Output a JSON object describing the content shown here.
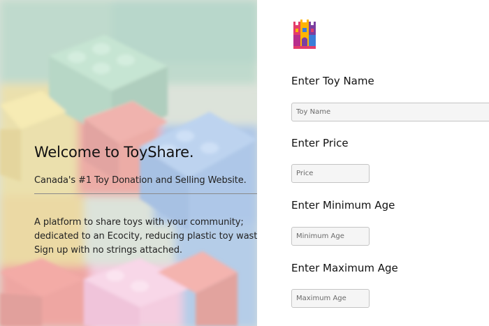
{
  "hero": {
    "title": "Welcome to ToyShare.",
    "tagline": "Canada's #1 Toy Donation and Selling Website.",
    "description_lines": [
      "A platform to share toys with your community;",
      "dedicated to an Ecocity, reducing plastic toy waste.",
      "Sign up with no strings attached."
    ],
    "background": "blurred colorful toy building bricks",
    "brick_colors": [
      "#5fae8a",
      "#4f86c8",
      "#e0c23a",
      "#d9524a",
      "#e8a4c8",
      "#9fbf9a"
    ]
  },
  "logo": {
    "icon": "castle-logo-icon",
    "colors": [
      "#e43d6b",
      "#ffb400",
      "#3b7dd8",
      "#7b3fa0"
    ]
  },
  "form": {
    "fields": [
      {
        "label": "Enter Toy Name",
        "placeholder": "Toy Name"
      },
      {
        "label": "Enter Price",
        "placeholder": "Price"
      },
      {
        "label": "Enter Minimum Age",
        "placeholder": "Minimum Age"
      },
      {
        "label": "Enter Maximum Age",
        "placeholder": "Maximum Age"
      }
    ]
  }
}
